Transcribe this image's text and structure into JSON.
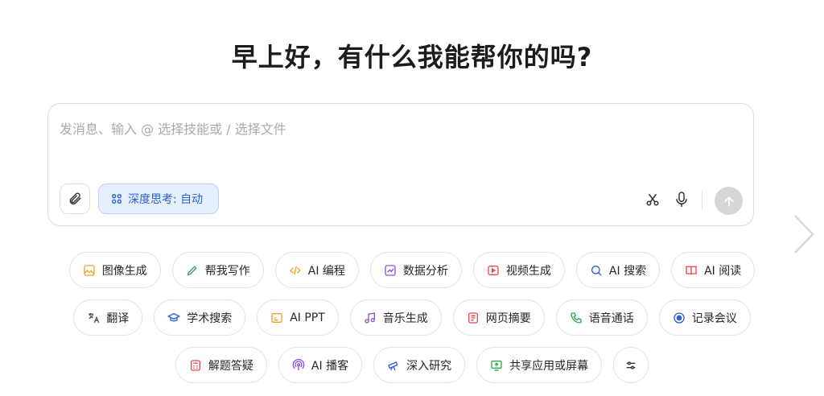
{
  "greeting": "早上好，有什么我能帮你的吗?",
  "composer": {
    "placeholder": "发消息、输入 @ 选择技能或 / 选择文件",
    "deep_think_label": "深度思考: 自动"
  },
  "chips": {
    "row1": [
      {
        "label": "图像生成",
        "icon": "image-icon",
        "color": "#f0a020"
      },
      {
        "label": "帮我写作",
        "icon": "pen-icon",
        "color": "#2ea44f"
      },
      {
        "label": "AI 编程",
        "icon": "code-icon",
        "color": "#f0a020"
      },
      {
        "label": "数据分析",
        "icon": "chart-icon",
        "color": "#8a4fd8"
      },
      {
        "label": "视频生成",
        "icon": "video-icon",
        "color": "#e5484d"
      },
      {
        "label": "AI 搜索",
        "icon": "search-icon",
        "color": "#2a5fd6"
      },
      {
        "label": "AI 阅读",
        "icon": "book-icon",
        "color": "#e5484d"
      }
    ],
    "row2": [
      {
        "label": "翻译",
        "icon": "translate-icon",
        "color": "#555555"
      },
      {
        "label": "学术搜索",
        "icon": "academic-cap-icon",
        "color": "#2a5fd6"
      },
      {
        "label": "AI PPT",
        "icon": "slides-icon",
        "color": "#f0a020"
      },
      {
        "label": "音乐生成",
        "icon": "music-icon",
        "color": "#8a4fd8"
      },
      {
        "label": "网页摘要",
        "icon": "webpage-icon",
        "color": "#e5484d"
      },
      {
        "label": "语音通话",
        "icon": "phone-icon",
        "color": "#2ea44f"
      },
      {
        "label": "记录会议",
        "icon": "record-icon",
        "color": "#2a5fd6"
      }
    ],
    "row3": [
      {
        "label": "解题答疑",
        "icon": "calculator-icon",
        "color": "#e5484d"
      },
      {
        "label": "AI 播客",
        "icon": "podcast-icon",
        "color": "#8a4fd8"
      },
      {
        "label": "深入研究",
        "icon": "telescope-icon",
        "color": "#2a5fd6"
      },
      {
        "label": "共享应用或屏幕",
        "icon": "screen-share-icon",
        "color": "#2ea44f"
      }
    ]
  }
}
